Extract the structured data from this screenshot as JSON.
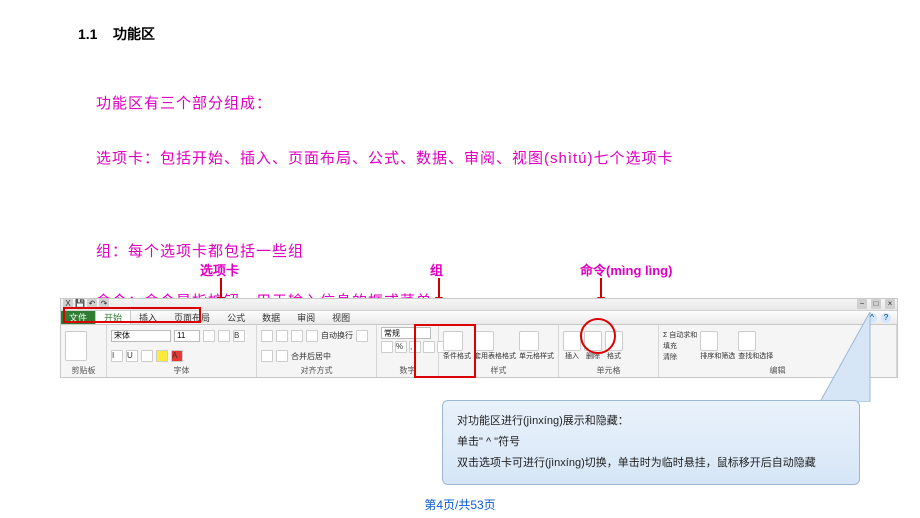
{
  "section": {
    "number": "1.1",
    "title": "功能区"
  },
  "intro": "功能区有三个部分组成：",
  "tabs_line": "选项卡：包括开始、插入、页面布局、公式、数据、审阅、视图(shìtú)七个选项卡",
  "groups_line": "组：每个选项卡都包括一些组",
  "commands_line": "命令：命令是指按钮、用于输入信息的框或菜单",
  "anno": {
    "tab": "选项卡",
    "group": "组",
    "command": "命令(mìng lìng)"
  },
  "ribbon": {
    "file": "文件",
    "tabs": [
      "开始",
      "插入",
      "页面布局",
      "公式",
      "数据",
      "审阅",
      "视图"
    ],
    "font_name": "宋体",
    "font_size": "11",
    "number_format": "常规",
    "groups": {
      "clipboard": "剪贴板",
      "font": "字体",
      "alignment": "对齐方式",
      "number": "数字",
      "styles": "样式",
      "cells": "单元格",
      "editing": "编辑"
    },
    "style_btns": [
      "条件格式",
      "套用表格格式",
      "单元格样式"
    ],
    "cell_btns": [
      "插入",
      "删除",
      "格式"
    ],
    "edit_btns": [
      "Σ 自动求和",
      "填充",
      "清除"
    ],
    "edit_r": [
      "排序和筛选",
      "查找和选择"
    ],
    "align_merge": "合并后居中",
    "align_wrap": "自动换行"
  },
  "callout": {
    "l1": "对功能区进行(jìnxíng)展示和隐藏：",
    "l2": "单击\" ^ \"符号",
    "l3": "双击选项卡可进行(jìnxíng)切换，单击时为临时悬挂，鼠标移开后自动隐藏"
  },
  "footer": "第4页/共53页"
}
